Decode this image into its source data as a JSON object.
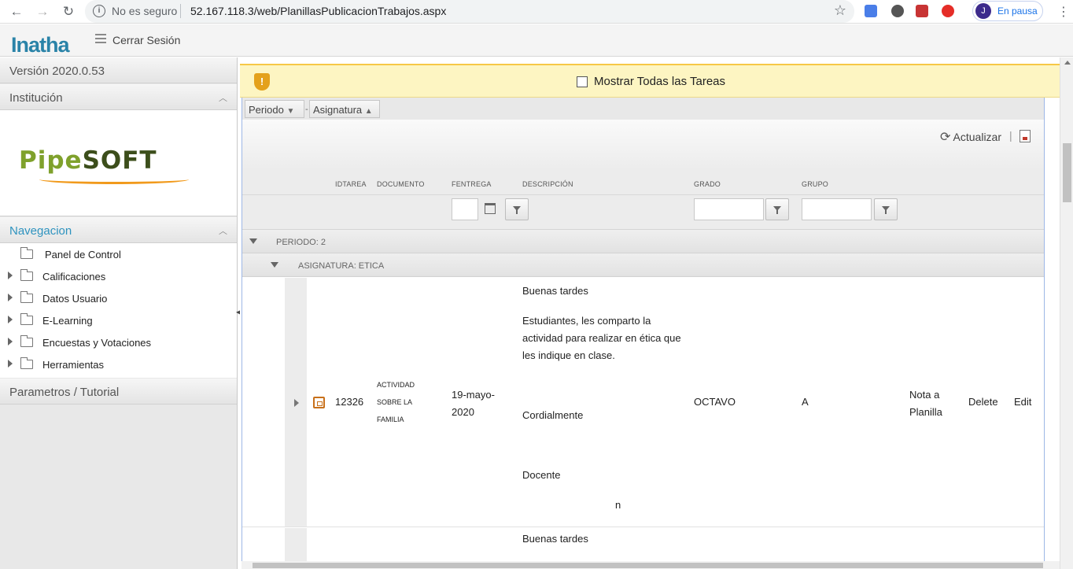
{
  "browser": {
    "security_text": "No es seguro",
    "url": "52.167.118.3/web/PlanillasPublicacionTrabajos.aspx",
    "profile_initial": "J",
    "profile_status": "En pausa"
  },
  "app": {
    "logo_text": "Inatha",
    "logout_label": "Cerrar Sesión"
  },
  "sidebar": {
    "version": "Versión 2020.0.53",
    "institution_label": "Institución",
    "institution_logo": "Pipesoft",
    "nav_header": "Navegacion",
    "nav_items": [
      {
        "label": "Panel de Control",
        "expandable": false
      },
      {
        "label": "Calificaciones",
        "expandable": true
      },
      {
        "label": "Datos Usuario",
        "expandable": true
      },
      {
        "label": "E-Learning",
        "expandable": true
      },
      {
        "label": "Encuestas y Votaciones",
        "expandable": true
      },
      {
        "label": "Herramientas",
        "expandable": true
      }
    ],
    "params_label": "Parametros / Tutorial"
  },
  "banner": {
    "show_all_label": "Mostrar Todas las Tareas",
    "show_all_checked": false
  },
  "grid": {
    "group_chips": [
      "Periodo",
      "Asignatura"
    ],
    "refresh_label": "Actualizar",
    "columns": [
      "IDTAREA",
      "DOCUMENTO",
      "FENTREGA",
      "DESCRIPCIÓN",
      "GRADO",
      "GRUPO"
    ],
    "group_period": "PERIODO: 2",
    "group_subject": "ASIGNATURA: ETICA",
    "rows": [
      {
        "id": "12326",
        "documento": [
          "ACTIVIDAD",
          "SOBRE LA",
          "FAMILIA"
        ],
        "fentrega": [
          "19-mayo-",
          "2020"
        ],
        "descripcion": {
          "greeting": "Buenas tardes",
          "body": [
            "Estudiantes, les comparto la",
            "actividad para realizar en ética que",
            "les indique en clase."
          ],
          "closing": "Cordialmente",
          "signature": "Docente",
          "trailing": "n"
        },
        "grado": "OCTAVO",
        "grupo": "A",
        "nota_planilla": [
          "Nota a",
          "Planilla"
        ],
        "delete": "Delete",
        "edit": "Edit"
      },
      {
        "descripcion_greeting": "Buenas tardes"
      }
    ]
  }
}
